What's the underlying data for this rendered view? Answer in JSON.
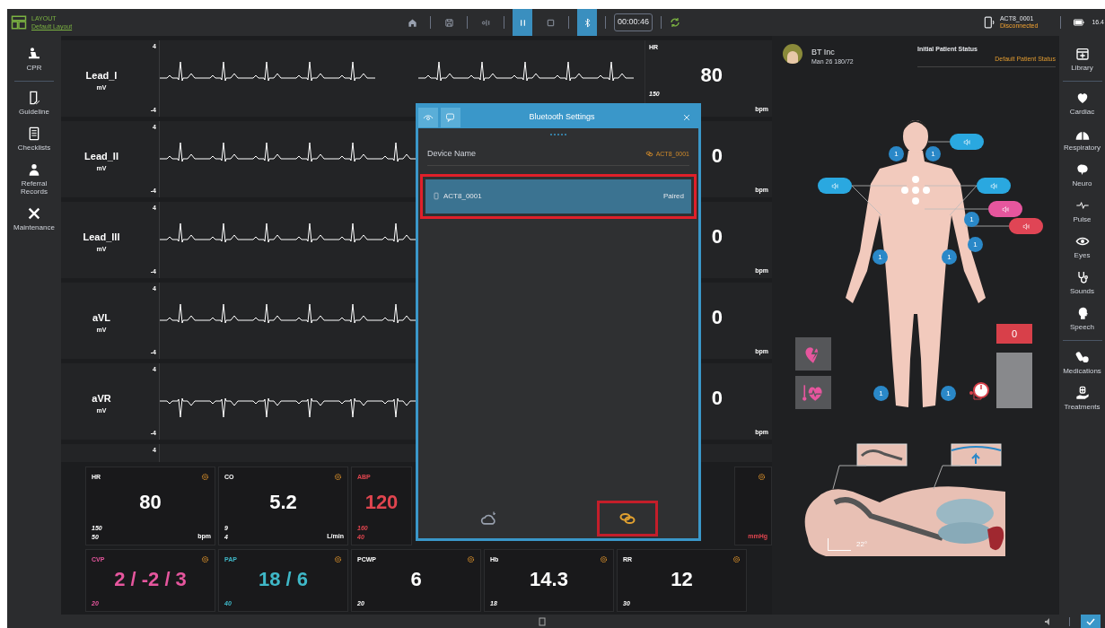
{
  "top_bar": {
    "layout_label": "LAYOUT",
    "layout_name": "Default Layout",
    "tools": [
      {
        "kind": "home",
        "active": false
      },
      {
        "kind": "save",
        "active": false
      },
      {
        "kind": "audio",
        "active": false
      },
      {
        "kind": "pause",
        "active": true
      },
      {
        "kind": "stop",
        "active": false
      },
      {
        "kind": "bluetooth",
        "active": true
      }
    ],
    "timer": "00:00:46",
    "device": {
      "name": "ACT8_0001",
      "status": "Disconnected"
    },
    "battery": "16.4"
  },
  "left_sidebar": [
    {
      "kind": "cpr",
      "label": "CPR",
      "divider_after": true
    },
    {
      "kind": "guideline",
      "label": "Guideline",
      "divider_after": false
    },
    {
      "kind": "checklists",
      "label": "Checklists",
      "divider_after": false
    },
    {
      "kind": "records",
      "label": "Referral Records",
      "divider_after": false
    },
    {
      "kind": "maintenance",
      "label": "Maintenance",
      "divider_after": false
    }
  ],
  "waveforms": [
    {
      "label": "Lead_I",
      "unit": "mV",
      "scale_max": "4",
      "scale_min": "-4",
      "readout": {
        "name": "HR",
        "value": "80",
        "limit": "150",
        "unit": "bpm"
      }
    },
    {
      "label": "Lead_II",
      "unit": "mV",
      "scale_max": "4",
      "scale_min": "-4",
      "readout": {
        "value": "0",
        "unit": "bpm"
      }
    },
    {
      "label": "Lead_III",
      "unit": "mV",
      "scale_max": "4",
      "scale_min": "-4",
      "readout": {
        "value": "0",
        "unit": "bpm"
      }
    },
    {
      "label": "aVL",
      "unit": "mV",
      "scale_max": "4",
      "scale_min": "-4",
      "readout": {
        "value": "0",
        "unit": "bpm"
      }
    },
    {
      "label": "aVR",
      "unit": "mV",
      "scale_max": "4",
      "scale_min": "-4",
      "readout": {
        "value": "0",
        "unit": "bpm"
      }
    }
  ],
  "partial_row_scale": "4",
  "vitals": [
    [
      {
        "kind": "vital",
        "label": "HR",
        "value": "80",
        "limits": [
          "150",
          "50"
        ],
        "unit": "bpm",
        "color": "#ffffff"
      },
      {
        "kind": "vital",
        "label": "CO",
        "value": "5.2",
        "limits": [
          "9",
          "4"
        ],
        "unit": "L/min",
        "color": "#ffffff"
      },
      {
        "kind": "clipped",
        "label": "ABP",
        "value": "120",
        "limits": [
          "160",
          "40"
        ],
        "color": "#e0454f"
      },
      {
        "kind": "edge",
        "unit": "mmHg",
        "color": "#e0454f"
      }
    ],
    [
      {
        "kind": "vital",
        "label": "CVP",
        "value": "2 / -2 / 3",
        "limits": [
          "20"
        ],
        "color": "#e6569e"
      },
      {
        "kind": "vital",
        "label": "PAP",
        "value": "18 / 6",
        "limits": [
          "40"
        ],
        "color": "#3fb8c8"
      },
      {
        "kind": "vital",
        "label": "PCWP",
        "value": "6",
        "limits": [
          "20"
        ],
        "color": "#ffffff"
      },
      {
        "kind": "vital",
        "label": "Hb",
        "value": "14.3",
        "limits": [
          "18"
        ],
        "color": "#ffffff"
      },
      {
        "kind": "vital",
        "label": "RR",
        "value": "12",
        "limits": [
          "30"
        ],
        "color": "#ffffff"
      }
    ]
  ],
  "dialog": {
    "title": "Bluetooth Settings",
    "header_buttons": [
      {
        "kind": "visibility"
      },
      {
        "kind": "chat"
      }
    ],
    "column_label": "Device Name",
    "connected_device": "ACT8_0001",
    "devices": [
      {
        "name": "ACT8_0001",
        "status": "Paired",
        "selected": true,
        "highlighted": true
      }
    ],
    "footer_buttons": [
      {
        "kind": "cloud",
        "highlighted": false
      },
      {
        "kind": "link",
        "highlighted": true
      }
    ]
  },
  "patient": {
    "name": "BT Inc",
    "details": "Man 26 180/72",
    "status_label": "Initial Patient Status",
    "status_value": "Default Patient Status"
  },
  "body_map": {
    "sound_points": [
      {
        "color": "#2aa8e0"
      },
      {
        "color": "#2aa8e0"
      },
      {
        "color": "#2aa8e0"
      },
      {
        "color": "#e6569e"
      },
      {
        "color": "#e04555"
      }
    ],
    "pulse_points": [
      {
        "label": "1"
      },
      {
        "label": "1"
      },
      {
        "label": "1"
      },
      {
        "label": "1"
      },
      {
        "label": "1"
      },
      {
        "label": "1"
      },
      {
        "label": "1"
      },
      {
        "label": "1"
      }
    ],
    "gauge_value": "0",
    "head_angle": "22°"
  },
  "right_sidebar": [
    {
      "kind": "library",
      "label": "Library",
      "divider_after": true
    },
    {
      "kind": "cardiac",
      "label": "Cardiac",
      "divider_after": false
    },
    {
      "kind": "respiratory",
      "label": "Respiratory",
      "divider_after": false
    },
    {
      "kind": "neuro",
      "label": "Neuro",
      "divider_after": false
    },
    {
      "kind": "pulse",
      "label": "Pulse",
      "divider_after": false
    },
    {
      "kind": "eyes",
      "label": "Eyes",
      "divider_after": false
    },
    {
      "kind": "sounds",
      "label": "Sounds",
      "divider_after": false
    },
    {
      "kind": "speech",
      "label": "Speech",
      "divider_after": true
    },
    {
      "kind": "medications",
      "label": "Medications",
      "divider_after": false
    },
    {
      "kind": "treatments",
      "label": "Treatments",
      "divider_after": false
    }
  ]
}
